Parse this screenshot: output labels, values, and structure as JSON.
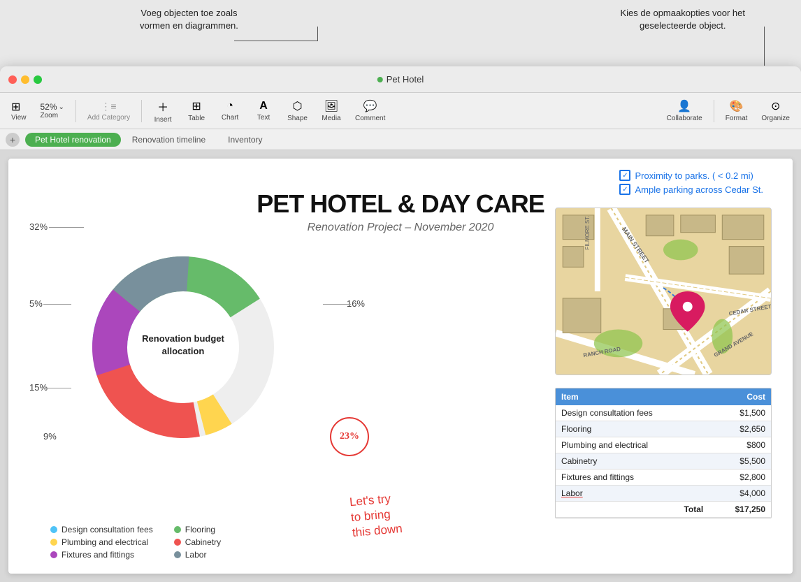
{
  "tooltip": {
    "left_text": "Voeg objecten toe zoals\nvormen en diagrammen.",
    "right_text": "Kies de opmaakopties voor het\ngeselecteerde object."
  },
  "titlebar": {
    "title": "Pet Hotel",
    "traffic_lights": [
      "red",
      "yellow",
      "green"
    ]
  },
  "toolbar": {
    "view_label": "View",
    "zoom_value": "52%",
    "zoom_label": "Zoom",
    "add_category_label": "Add Category",
    "insert_label": "Insert",
    "table_label": "Table",
    "chart_label": "Chart",
    "text_label": "Text",
    "shape_label": "Shape",
    "media_label": "Media",
    "comment_label": "Comment",
    "collaborate_label": "Collaborate",
    "format_label": "Format",
    "organize_label": "Organize"
  },
  "tabs": {
    "add_tooltip": "+",
    "items": [
      {
        "label": "Pet Hotel renovation",
        "active": true
      },
      {
        "label": "Renovation timeline",
        "active": false
      },
      {
        "label": "Inventory",
        "active": false
      }
    ]
  },
  "page": {
    "title": "PET HOTEL & DAY CARE",
    "subtitle": "Renovation Project – November 2020"
  },
  "chart": {
    "center_text": "Renovation budget\nallocation",
    "labels": [
      {
        "text": "32%",
        "position": "top-left"
      },
      {
        "text": "16%",
        "position": "right"
      },
      {
        "text": "5%",
        "position": "left-mid"
      },
      {
        "text": "15%",
        "position": "left-bottom"
      },
      {
        "text": "9%",
        "position": "bottom-left"
      },
      {
        "text": "23%",
        "position": "bottom-right"
      }
    ],
    "segments": [
      {
        "label": "Design consultation fees",
        "color": "#4fc3f7",
        "percent": 9
      },
      {
        "label": "Flooring",
        "color": "#66bb6a",
        "percent": 32
      },
      {
        "label": "Plumbing and electrical",
        "color": "#ffd54f",
        "percent": 5
      },
      {
        "label": "Cabinetry",
        "color": "#ef5350",
        "percent": 23
      },
      {
        "label": "Fixtures and fittings",
        "color": "#ab47bc",
        "percent": 16
      },
      {
        "label": "Labor",
        "color": "#78909c",
        "percent": 15
      }
    ]
  },
  "legend": {
    "col1": [
      {
        "label": "Design consultation fees",
        "color": "#4fc3f7"
      },
      {
        "label": "Plumbing and electrical",
        "color": "#ffd54f"
      },
      {
        "label": "Fixtures and fittings",
        "color": "#ab47bc"
      }
    ],
    "col2": [
      {
        "label": "Flooring",
        "color": "#66bb6a"
      },
      {
        "label": "Cabinetry",
        "color": "#ef5350"
      },
      {
        "label": "Labor",
        "color": "#78909c"
      }
    ]
  },
  "map_notes": [
    {
      "text": "Proximity to parks. ( < 0.2 mi)"
    },
    {
      "text": "Ample parking across  Cedar St."
    }
  ],
  "table": {
    "headers": [
      "Item",
      "Cost"
    ],
    "rows": [
      {
        "item": "Design consultation fees",
        "cost": "$1,500"
      },
      {
        "item": "Flooring",
        "cost": "$2,650"
      },
      {
        "item": "Plumbing and electrical",
        "cost": "$800"
      },
      {
        "item": "Cabinetry",
        "cost": "$5,500"
      },
      {
        "item": "Fixtures and fittings",
        "cost": "$2,800"
      },
      {
        "item": "Labor",
        "cost": "$4,000"
      }
    ],
    "total_label": "Total",
    "total_value": "$17,250"
  },
  "annotations": {
    "circle_label": "23%",
    "handwrite_text": "Let's try\nto bring\nthis down"
  }
}
